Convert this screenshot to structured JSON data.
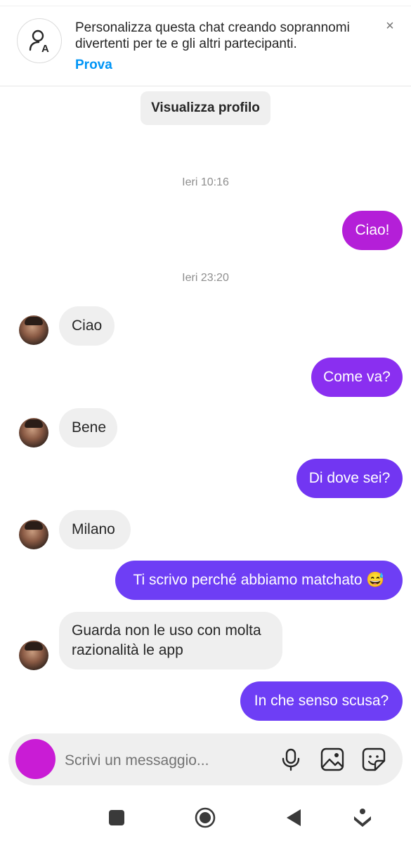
{
  "banner": {
    "text": "Personalizza questa chat creando soprannomi divertenti per te e gli altri partecipanti.",
    "action_label": "Prova",
    "close_symbol": "×",
    "icon": "nickname-icon"
  },
  "profile_button_label": "Visualizza profilo",
  "colors": {
    "bubble_magenta": "#b41fd8",
    "bubble_purple_mid": "#8a2ff0",
    "bubble_purple": "#6e3ef5",
    "bubble_incoming": "#efefef",
    "composer_avatar": "#c91cd5",
    "link_blue": "#0095f6"
  },
  "messages": [
    {
      "type": "timestamp",
      "text": "Ieri 10:16"
    },
    {
      "type": "out",
      "text": "Ciao!"
    },
    {
      "type": "timestamp",
      "text": "Ieri 23:20"
    },
    {
      "type": "in",
      "text": "Ciao"
    },
    {
      "type": "out",
      "text": "Come va?"
    },
    {
      "type": "in",
      "text": "Bene"
    },
    {
      "type": "out",
      "text": "Di dove sei?"
    },
    {
      "type": "in",
      "text": "Milano"
    },
    {
      "type": "out",
      "text": "Ti scrivo perché abbiamo matchato 😅"
    },
    {
      "type": "in",
      "text": "Guarda non le uso con molta razionalità le app"
    },
    {
      "type": "out",
      "text": "In che senso scusa?"
    }
  ],
  "composer": {
    "placeholder": "Scrivi un messaggio...",
    "icons": [
      "microphone-icon",
      "gallery-icon",
      "sticker-icon"
    ]
  },
  "navbar": {
    "icons": [
      "recents-icon",
      "home-icon",
      "back-icon",
      "assistant-icon"
    ]
  }
}
